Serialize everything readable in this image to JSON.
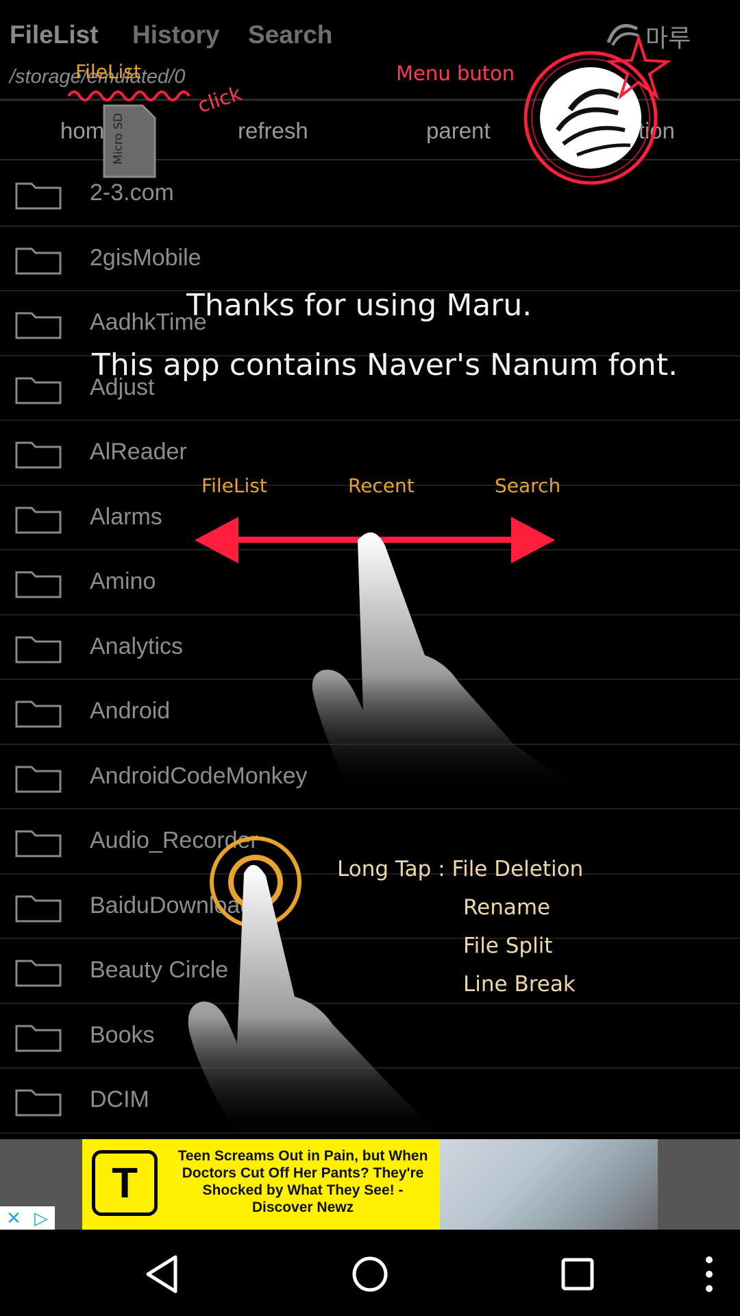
{
  "tabs": [
    {
      "label": "FileList",
      "active": true
    },
    {
      "label": "History",
      "active": false
    },
    {
      "label": "Search",
      "active": false
    }
  ],
  "path": "/storage/emulated/0",
  "toolbar": [
    "home",
    "refresh",
    "parent",
    "option"
  ],
  "files": [
    "2-3.com",
    "2gisMobile",
    "AadhkTime",
    "Adjust",
    "AlReader",
    "Alarms",
    "Amino",
    "Analytics",
    "Android",
    "AndroidCodeMonkey",
    "Audio_Recorder",
    "BaiduDownload",
    "Beauty Circle",
    "Books",
    "DCIM"
  ],
  "overlay": {
    "filelist_click_label": "FileList",
    "click_label": "click",
    "menu_button_label": "Menu buton",
    "thanks_line1": "Thanks for using Maru.",
    "thanks_line2": "This app contains Naver's Nanum font.",
    "swipe_labels": [
      "FileList",
      "Recent",
      "Search"
    ],
    "long_tap_title": "Long Tap : File Deletion",
    "long_tap_items": [
      "Rename",
      "File Split",
      "Line Break"
    ],
    "sd_card_text": "Micro SD"
  },
  "ad": {
    "logo": "T",
    "text": "Teen Screams Out in Pain, but When Doctors Cut Off Her Pants? They're Shocked by What They See! - Discover Newz",
    "close_icon": "close-icon",
    "adchoices_icon": "adchoices-icon"
  },
  "colors": {
    "overlay_red": "#ff1e3c",
    "orange": "#e7a32c",
    "ad_yellow": "#fff100"
  }
}
